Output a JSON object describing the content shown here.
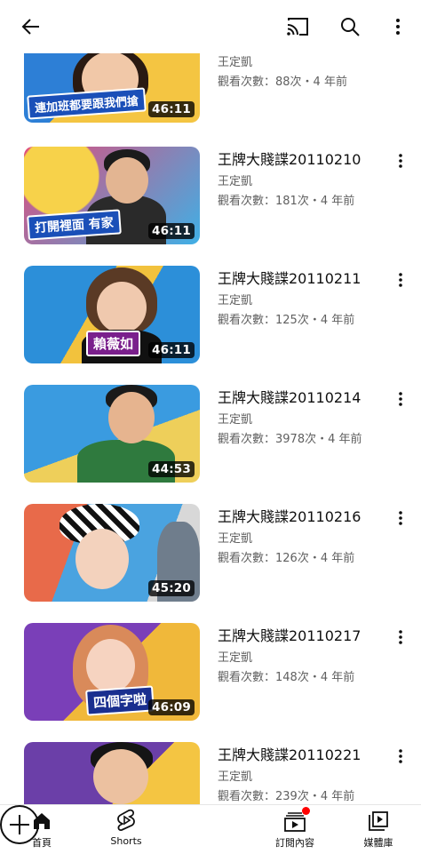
{
  "topbar": {
    "back_icon": "arrow-left-icon",
    "cast_icon": "cast-icon",
    "search_icon": "search-icon",
    "more_icon": "more-vert-icon"
  },
  "videos": [
    {
      "title": "",
      "channel": "王定凱",
      "meta": "觀看次數：88次・4 年前",
      "duration": "46:11",
      "caption": "連加班都要跟我們搶",
      "colors": [
        "#2d7fd6",
        "#f4c542"
      ]
    },
    {
      "title": "王牌大賤諜20110210",
      "channel": "王定凱",
      "meta": "觀看次數：181次・4 年前",
      "duration": "46:11",
      "caption": "打開裡面 有家",
      "colors": [
        "#e14b7a",
        "#f7d24a"
      ]
    },
    {
      "title": "王牌大賤諜20110211",
      "channel": "王定凱",
      "meta": "觀看次數：125次・4 年前",
      "duration": "46:11",
      "caption": "賴薇如",
      "colors": [
        "#2c8fd9",
        "#f2c23d"
      ]
    },
    {
      "title": "王牌大賤諜20110214",
      "channel": "王定凱",
      "meta": "觀看次數：3978次・4 年前",
      "duration": "44:53",
      "caption": "",
      "colors": [
        "#3a9be0",
        "#eecf5a"
      ]
    },
    {
      "title": "王牌大賤諜20110216",
      "channel": "王定凱",
      "meta": "觀看次數：126次・4 年前",
      "duration": "45:20",
      "caption": "",
      "colors": [
        "#e86a4a",
        "#4aa3e0"
      ]
    },
    {
      "title": "王牌大賤諜20110217",
      "channel": "王定凱",
      "meta": "觀看次數：148次・4 年前",
      "duration": "46:09",
      "caption": "四個字啦",
      "colors": [
        "#7a3fb8",
        "#f0b83a"
      ]
    },
    {
      "title": "王牌大賤諜20110221",
      "channel": "王定凱",
      "meta": "觀看次數：239次・4 年前",
      "duration": "",
      "caption": "",
      "colors": [
        "#6b3fa8",
        "#f4c542"
      ]
    }
  ],
  "bottomnav": {
    "home": {
      "label": "首頁",
      "icon": "home-icon"
    },
    "shorts": {
      "label": "Shorts",
      "icon": "shorts-icon"
    },
    "create": {
      "icon": "add-circle-icon"
    },
    "subscriptions": {
      "label": "訂閱內容",
      "icon": "subscriptions-icon"
    },
    "library": {
      "label": "媒體庫",
      "icon": "library-icon"
    }
  },
  "colors": {
    "notification_dot": "#ff0000",
    "secondary_text": "#606060"
  }
}
